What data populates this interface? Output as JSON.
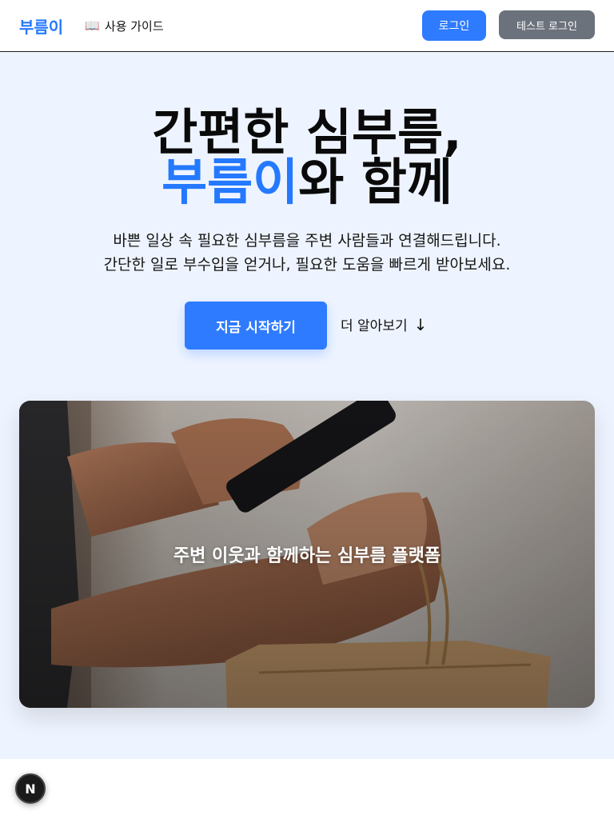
{
  "header": {
    "logo": "부름이",
    "guide_icon": "📖",
    "guide_label": "사용 가이드",
    "login_label": "로그인",
    "test_login_label": "테스트 로그인"
  },
  "hero": {
    "headline_line1": "간편한 심부름,",
    "headline_accent": "부름이",
    "headline_line2_rest": "와 함께",
    "sub_line1": "바쁜 일상 속 필요한 심부름을 주변 사람들과 연결해드립니다.",
    "sub_line2": "간단한 일로 부수입을 얻거나, 필요한 도움을 빠르게 받아보세요.",
    "cta_label": "지금 시작하기",
    "more_label": "더 알아보기",
    "more_arrow": "↓",
    "image_caption": "주변 이웃과 함께하는 심부름 플랫폼"
  },
  "badge": {
    "label": "N"
  },
  "colors": {
    "accent": "#2479ff",
    "hero_bg": "#eef4ff",
    "test_btn": "#6c727c"
  }
}
